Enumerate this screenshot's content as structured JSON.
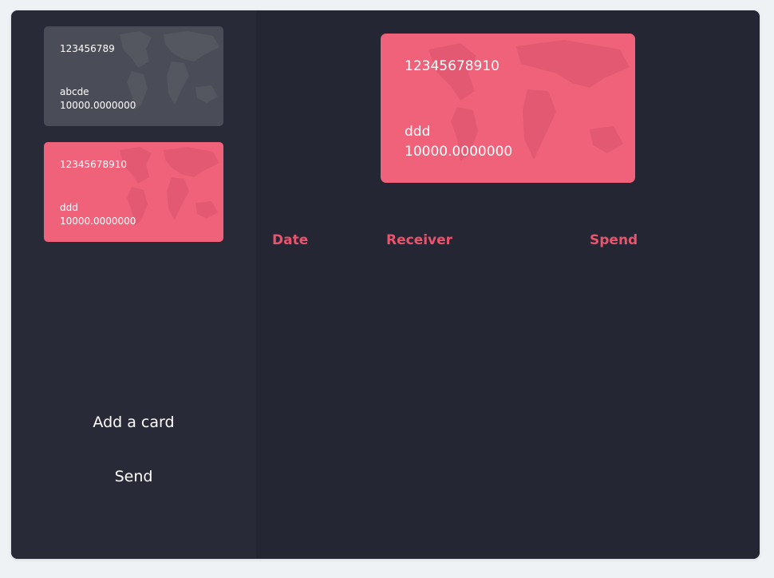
{
  "sidebar": {
    "cards": [
      {
        "number": "123456789",
        "name": "abcde",
        "balance": "10000.0000000",
        "color": "#4a4c57"
      },
      {
        "number": "12345678910",
        "name": "ddd",
        "balance": "10000.0000000",
        "color": "#f0627a"
      }
    ],
    "add_card_label": "Add a card",
    "send_label": "Send"
  },
  "selected_card": {
    "number": "12345678910",
    "name": "ddd",
    "balance": "10000.0000000",
    "color": "#f0627a"
  },
  "transactions": {
    "headers": [
      "Date",
      "Receiver",
      "Spend"
    ],
    "rows": []
  },
  "colors": {
    "background": "#242634",
    "sidebar": "#282a38",
    "accent": "#e8546d"
  }
}
